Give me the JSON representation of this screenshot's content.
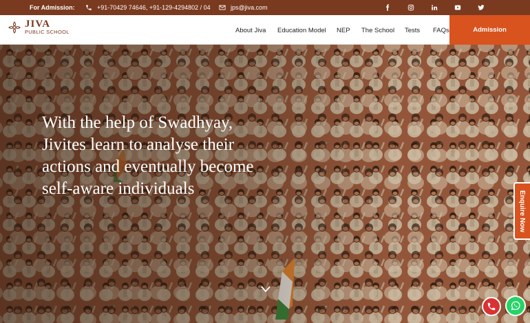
{
  "topbar": {
    "admission_label": "For Admission:",
    "phone": "+91-70429 74646, +91-129-4294802 / 04",
    "email": "jps@jiva.com",
    "icons": [
      "phone-icon",
      "mail-icon",
      "facebook-icon",
      "instagram-icon",
      "linkedin-icon",
      "youtube-icon",
      "twitter-icon"
    ]
  },
  "logo": {
    "name": "JIVA",
    "subtitle": "PUBLIC SCHOOL"
  },
  "nav": {
    "items": [
      "About Jiva",
      "Education Model",
      "NEP",
      "The School",
      "Tests",
      "FAQs"
    ],
    "cta": "Admission"
  },
  "hero": {
    "headline": "With the help of Swadhyay, Jivites learn to analyse their actions and eventually become self-aware individuals"
  },
  "enquire": "Enquire Now",
  "colors": {
    "brand": "#7a3a1f",
    "accent": "#d9531e",
    "whatsapp": "#25d366",
    "call": "#d93232"
  }
}
